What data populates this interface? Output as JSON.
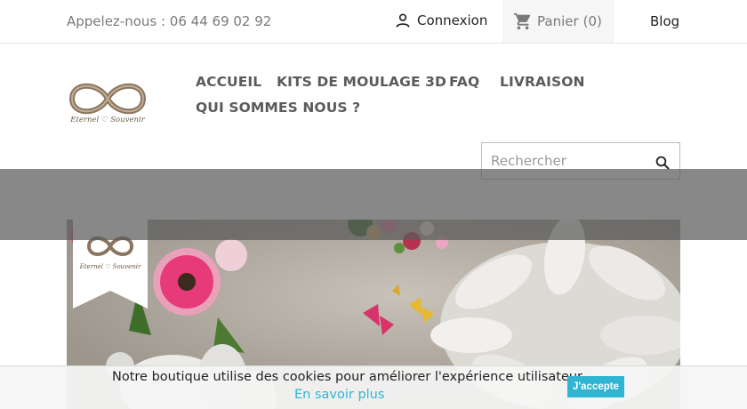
{
  "header": {
    "phone_text": "Appelez-nous : 06 44 69 02 92",
    "login_label": "Connexion",
    "login_icon": "user-icon",
    "cart_label": "Panier",
    "cart_count": "(0)",
    "cart_icon": "shopping-cart-icon",
    "blog_label": "Blog"
  },
  "brand": {
    "logo_line": "Eternel ♡ Souvenir",
    "logo_icon": "infinity-logo"
  },
  "nav": {
    "items": [
      {
        "label": "ACCUEIL"
      },
      {
        "label": "KITS DE MOULAGE 3D"
      },
      {
        "label": "FAQ"
      },
      {
        "label": "LIVRAISON"
      },
      {
        "label": "QUI SOMMES NOUS ?"
      }
    ]
  },
  "search": {
    "placeholder": "Rechercher",
    "icon": "search-icon"
  },
  "banner": {
    "badge_text": "Eternel ♡ Souvenir",
    "description_icon": "hands-casting-photo"
  },
  "cookie": {
    "message": "Notre boutique utilise des cookies pour améliorer l'expérience utilisateur.",
    "more_link": "En savoir plus",
    "accept_label": "J'accepte"
  },
  "colors": {
    "accent": "#2fb5d2",
    "logo_bronze": "#8a7560",
    "nav_text": "#5b5b5b"
  }
}
